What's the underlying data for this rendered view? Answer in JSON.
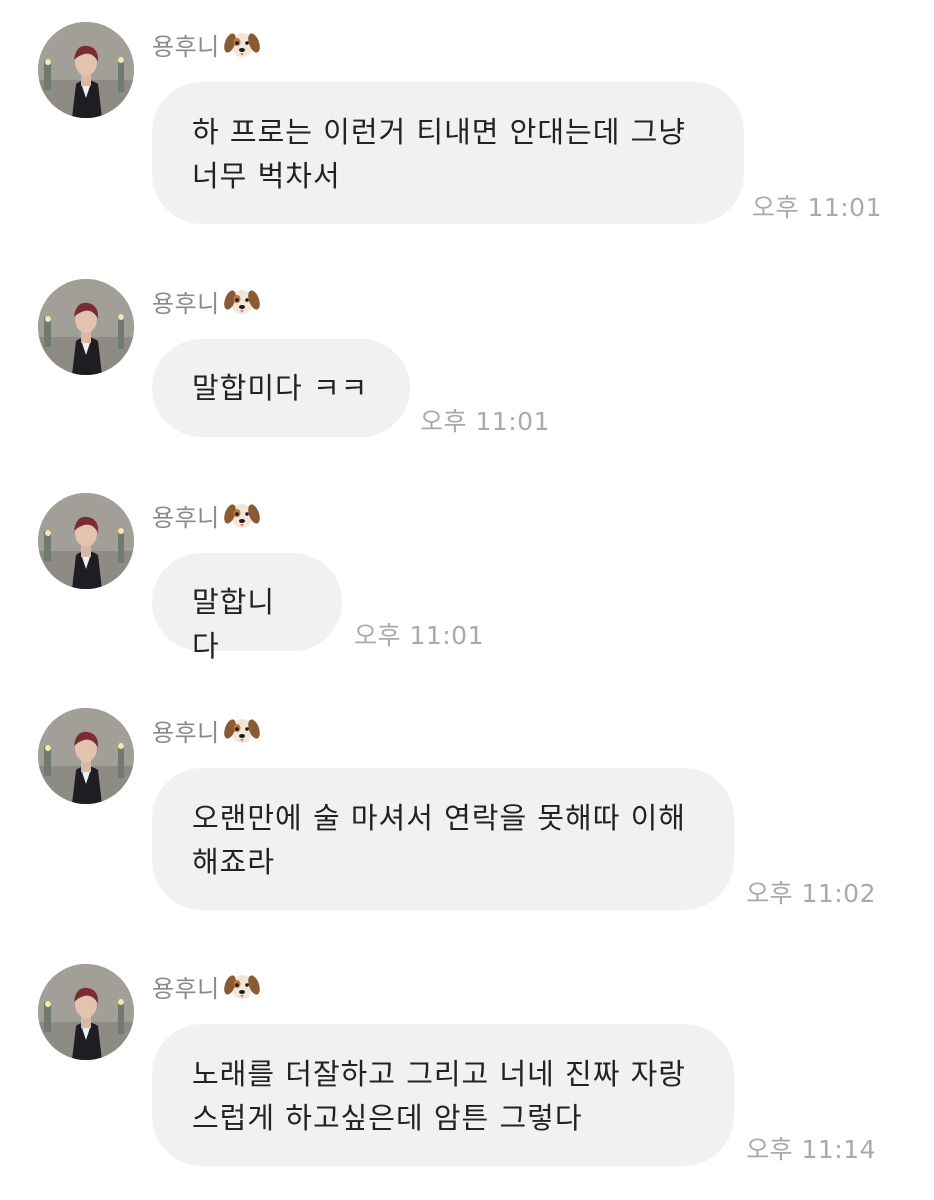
{
  "conversation": {
    "messages": [
      {
        "sender": "용후니",
        "sender_emoji": "dog-face-icon",
        "text": "하 프로는 이런거 티내면 안대는데 그냥\n너무 벅차서",
        "time": "오후 11:01"
      },
      {
        "sender": "용후니",
        "sender_emoji": "dog-face-icon",
        "text": "말합미다 ㅋㅋ",
        "time": "오후 11:01"
      },
      {
        "sender": "용후니",
        "sender_emoji": "dog-face-icon",
        "text": "말합니다",
        "time": "오후 11:01"
      },
      {
        "sender": "용후니",
        "sender_emoji": "dog-face-icon",
        "text": "오랜만에 술 마셔서 연락을 못해따 이해\n해죠라",
        "time": "오후 11:02"
      },
      {
        "sender": "용후니",
        "sender_emoji": "dog-face-icon",
        "text": "노래를 더잘하고 그리고 너네 진짜 자랑\n스럽게 하고싶은데 암튼 그렇다",
        "time": "오후 11:14"
      }
    ]
  },
  "colors": {
    "bubble_bg": "#f1f1f4",
    "text": "#222222",
    "sender_text": "#8a8a8e",
    "time_text": "#aaaaae"
  }
}
